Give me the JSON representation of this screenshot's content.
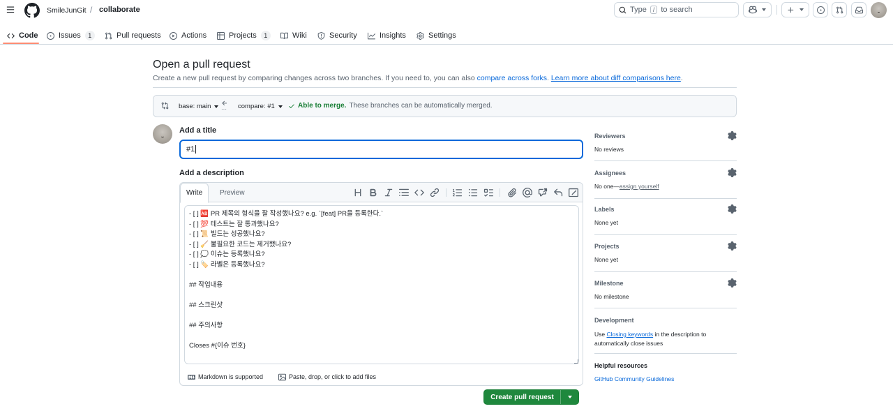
{
  "header": {
    "owner": "SmileJunGit",
    "separator": "/",
    "repo": "collaborate",
    "search": {
      "prefix": "Type",
      "key": "/",
      "suffix": "to search"
    }
  },
  "tabs": [
    {
      "label": "Code",
      "count": ""
    },
    {
      "label": "Issues",
      "count": "1"
    },
    {
      "label": "Pull requests",
      "count": ""
    },
    {
      "label": "Actions",
      "count": ""
    },
    {
      "label": "Projects",
      "count": "1"
    },
    {
      "label": "Wiki",
      "count": ""
    },
    {
      "label": "Security",
      "count": ""
    },
    {
      "label": "Insights",
      "count": ""
    },
    {
      "label": "Settings",
      "count": ""
    }
  ],
  "page": {
    "title": "Open a pull request",
    "subtitle_text": "Create a new pull request by comparing changes across two branches. If you need to, you can also ",
    "subtitle_link1": "compare across forks",
    "subtitle_sep": ". ",
    "subtitle_link2": "Learn more about diff comparisons here",
    "subtitle_end": "."
  },
  "merge": {
    "base": "base: main",
    "compare": "compare: #1",
    "status": "Able to merge.",
    "status_detail": "These branches can be automatically merged."
  },
  "form": {
    "title_label": "Add a title",
    "title_value": "#1",
    "desc_label": "Add a description",
    "tab_write": "Write",
    "tab_preview": "Preview",
    "body": "- [ ] 🆎 PR 제목의 형식을 잘 작성했나요? e.g. `[feat] PR을 등록한다.`\n- [ ] 💯 테스트는 잘 통과했나요?\n- [ ] 📜 빌드는 성공했나요?\n- [ ] 🧹 불필요한 코드는 제거했나요?\n- [ ] 💭 이슈는 등록했나요?\n- [ ] 🏷️ 라벨은 등록했나요?\n\n## 작업내용\n\n## 스크린샷\n\n## 주의사항\n\nCloses #{이슈 번호}",
    "markdown_note": "Markdown is supported",
    "files_note": "Paste, drop, or click to add files",
    "submit": "Create pull request"
  },
  "sidebar": {
    "reviewers": {
      "title": "Reviewers",
      "value": "No reviews"
    },
    "assignees": {
      "title": "Assignees",
      "value_prefix": "No one—",
      "value_link": "assign yourself"
    },
    "labels": {
      "title": "Labels",
      "value": "None yet"
    },
    "projects": {
      "title": "Projects",
      "value": "None yet"
    },
    "milestone": {
      "title": "Milestone",
      "value": "No milestone"
    },
    "development": {
      "title": "Development",
      "pre": "Use ",
      "link": "Closing keywords",
      "post": " in the description to automatically close issues"
    },
    "helpful": {
      "title": "Helpful resources",
      "link": "GitHub Community Guidelines"
    }
  },
  "colors": {
    "accent": "#0969da",
    "success": "#1f883d",
    "tab_underline": "#fd8c73",
    "border": "#d1d9e0"
  }
}
